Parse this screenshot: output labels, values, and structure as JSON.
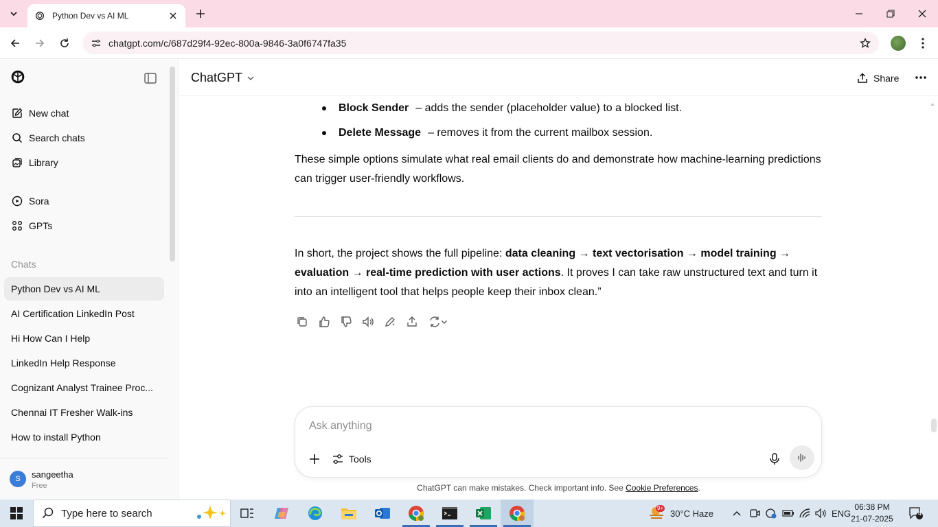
{
  "browser": {
    "tab_title": "Python Dev vs AI ML",
    "url": "chatgpt.com/c/687d29f4-92ec-800a-9846-3a0f6747fa35"
  },
  "sidebar": {
    "items_top": [
      {
        "label": "New chat",
        "icon": "edit-icon"
      },
      {
        "label": "Search chats",
        "icon": "search-icon"
      },
      {
        "label": "Library",
        "icon": "library-icon"
      }
    ],
    "items_mid": [
      {
        "label": "Sora",
        "icon": "play-circle-icon"
      },
      {
        "label": "GPTs",
        "icon": "grid-icon"
      }
    ],
    "section_label": "Chats",
    "chats": [
      "Python Dev vs AI ML",
      "AI Certification LinkedIn Post",
      "Hi How Can I Help",
      "LinkedIn Help Response",
      "Cognizant Analyst Trainee Proc...",
      "Chennai IT Fresher Walk-ins",
      "How to install Python"
    ],
    "user": {
      "initial": "S",
      "name": "sangeetha",
      "plan": "Free"
    }
  },
  "header": {
    "model": "ChatGPT",
    "share_label": "Share"
  },
  "message": {
    "bullets": [
      {
        "bold": "Block Sender",
        "text": "– adds the sender (placeholder value) to a blocked list."
      },
      {
        "bold": "Delete Message",
        "text": "– removes it from the current mailbox session."
      }
    ],
    "para1": "These simple options simulate what real email clients do and demonstrate how machine-learning predictions can trigger user-friendly workflows.",
    "para2_prefix": "In short, the project shows the full pipeline: ",
    "para2_bold": "data cleaning → text vectorisation → model training → evaluation → real-time prediction with user actions",
    "para2_suffix": ". It proves I can take raw unstructured text and turn it into an intelligent tool that helps people keep their inbox clean.”"
  },
  "composer": {
    "placeholder": "Ask anything",
    "tools_label": "Tools"
  },
  "disclaimer": {
    "text": "ChatGPT can make mistakes. Check important info. See ",
    "link": "Cookie Preferences",
    "end": "."
  },
  "taskbar": {
    "search_placeholder": "Type here to search",
    "weather": "30°C  Haze",
    "weather_badge": "9+",
    "lang": "ENG",
    "time": "06:38 PM",
    "date": "21-07-2025",
    "notification_count": "4"
  },
  "colors": {
    "tabbar": "#fbdce6",
    "sidebar": "#f9f9f9",
    "taskbar": "#dbe6f1",
    "accent": "#3c6eb4"
  }
}
